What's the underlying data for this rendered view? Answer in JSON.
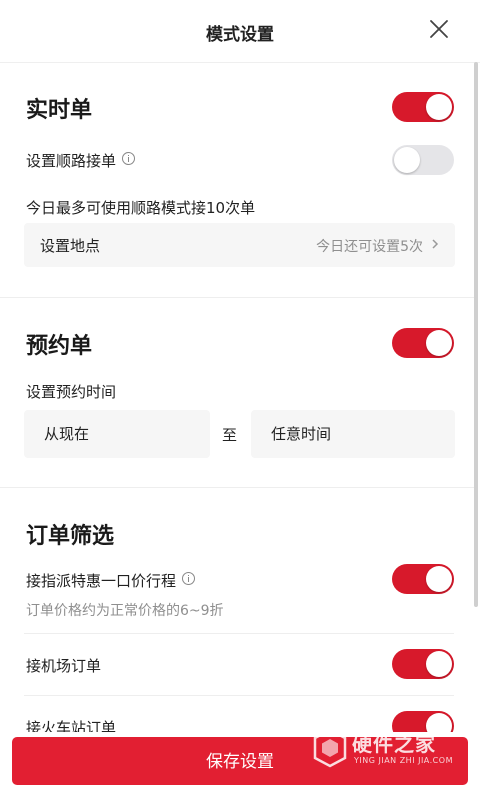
{
  "header": {
    "title": "模式设置",
    "close_icon": "close-icon"
  },
  "realtime": {
    "title": "实时单",
    "toggle_on": true,
    "route_label": "设置顺路接单",
    "route_toggle_on": false,
    "limit_text": "今日最多可使用顺路模式接10次单",
    "location_label": "设置地点",
    "location_hint": "今日还可设置5次"
  },
  "reservation": {
    "title": "预约单",
    "toggle_on": true,
    "time_label": "设置预约时间",
    "from": "从现在",
    "to_word": "至",
    "to": "任意时间"
  },
  "filter": {
    "title": "订单筛选",
    "items": [
      {
        "label": "接指派特惠一口价行程",
        "sub": "订单价格约为正常价格的6~9折",
        "on": true
      },
      {
        "label": "接机场订单",
        "on": true
      },
      {
        "label": "接火车站订单",
        "on": true
      }
    ]
  },
  "footer": {
    "save_label": "保存设置"
  },
  "watermark": {
    "text": "硬件之家",
    "sub": "YING JIAN ZHI JIA.COM"
  },
  "colors": {
    "accent": "#e21f32",
    "toggle_on": "#d7192b",
    "toggle_off": "#e5e5e8"
  }
}
